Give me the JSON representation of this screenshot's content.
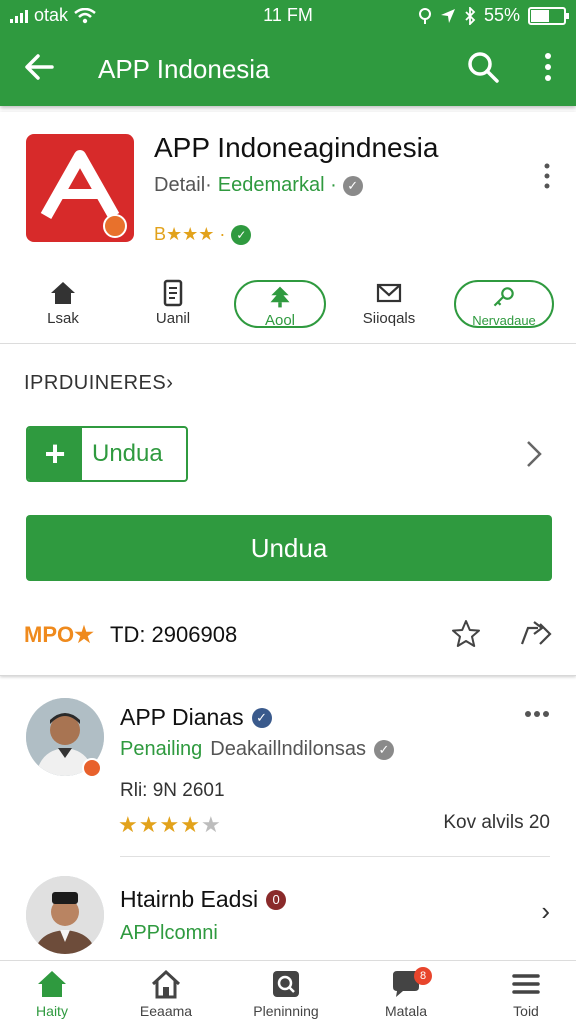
{
  "status": {
    "carrier": "otak",
    "time": "11 FM",
    "battery": "55%",
    "battery_level": 0.55
  },
  "appbar": {
    "title": "APP Indonesia",
    "icons": [
      "back-arrow-icon",
      "search-icon",
      "more-vert-icon"
    ]
  },
  "app": {
    "name": "APP Indoneagindnesia",
    "sub_label": "Detail·",
    "sub_green": "Eedemarkal ·",
    "rating_text": "B★★★ ·",
    "rating_value": 3
  },
  "actions": [
    {
      "label": "Lsak",
      "icon": "home-icon"
    },
    {
      "label": "Uanil",
      "icon": "document-icon"
    },
    {
      "label": "Aool",
      "icon": "tree-icon"
    },
    {
      "label": "Siioqals",
      "icon": "mail-icon"
    },
    {
      "label": "Nervadaue",
      "icon": "key-icon"
    }
  ],
  "section_label": "IPRDUINERES›",
  "install_small": "Undua",
  "install_big": "Undua",
  "meta": {
    "tag": "MPO★",
    "text": "TD: 2906908"
  },
  "list": [
    {
      "title": "APP Dianas",
      "sub_green": "Penailing",
      "sub_rest": "Deakaillndilonsas",
      "meta": "Rli: 9N 2601",
      "stars": 4,
      "right": "Kov alvils 20"
    },
    {
      "title": "Htairnb Eadsi",
      "sub_green": "APPlcomni",
      "right": "›"
    }
  ],
  "bottomnav": [
    {
      "label": "Haity",
      "icon": "home-icon",
      "active": true
    },
    {
      "label": "Eeaama",
      "icon": "house-icon",
      "active": false
    },
    {
      "label": "Pleninning",
      "icon": "search-box-icon",
      "active": false
    },
    {
      "label": "Matala",
      "icon": "chat-icon",
      "active": false,
      "badge": "8"
    },
    {
      "label": "Toid",
      "icon": "menu-icon",
      "active": false
    }
  ],
  "colors": {
    "primary": "#2f9a3f",
    "app_icon": "#d72a2a",
    "accent_orange": "#ef8a1d",
    "star": "#e2a21b"
  }
}
